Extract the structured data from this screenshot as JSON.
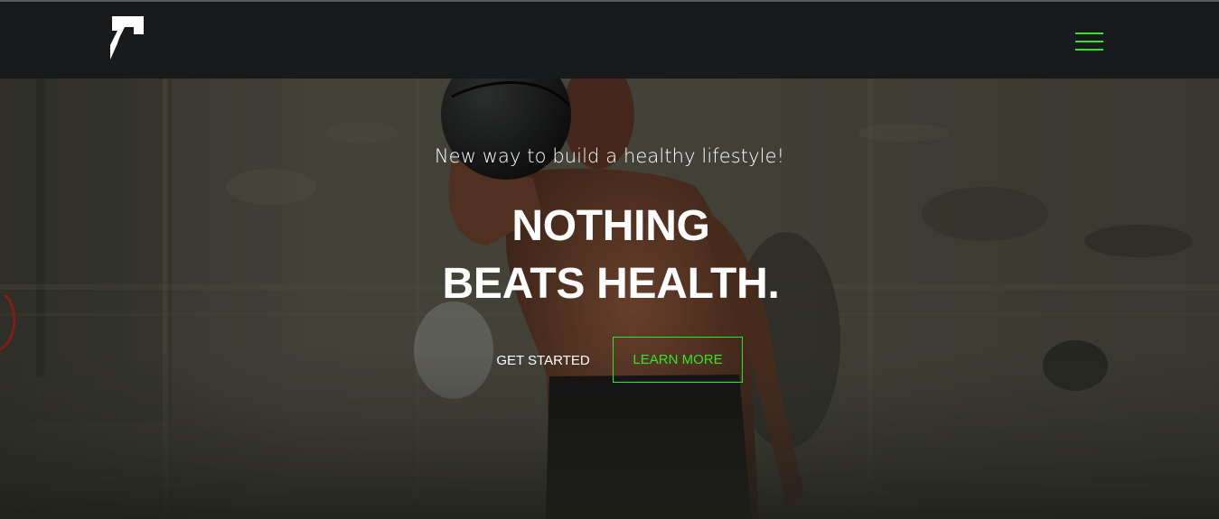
{
  "brand": {
    "logo": "brand-logo-icon"
  },
  "nav": {
    "menu_icon": "hamburger-menu-icon",
    "accent": "#2ee62a"
  },
  "hero": {
    "tagline": "New way to build a healthy lifestyle!",
    "headline_line1": "NOTHING",
    "headline_line2": "BEATS HEALTH.",
    "primary_button": "GET STARTED",
    "secondary_button": "LEARN MORE",
    "background_image": "athlete-with-medicine-ball"
  },
  "colors": {
    "nav_bg": "#18191b",
    "accent": "#2ee62a",
    "text": "#ffffff"
  }
}
